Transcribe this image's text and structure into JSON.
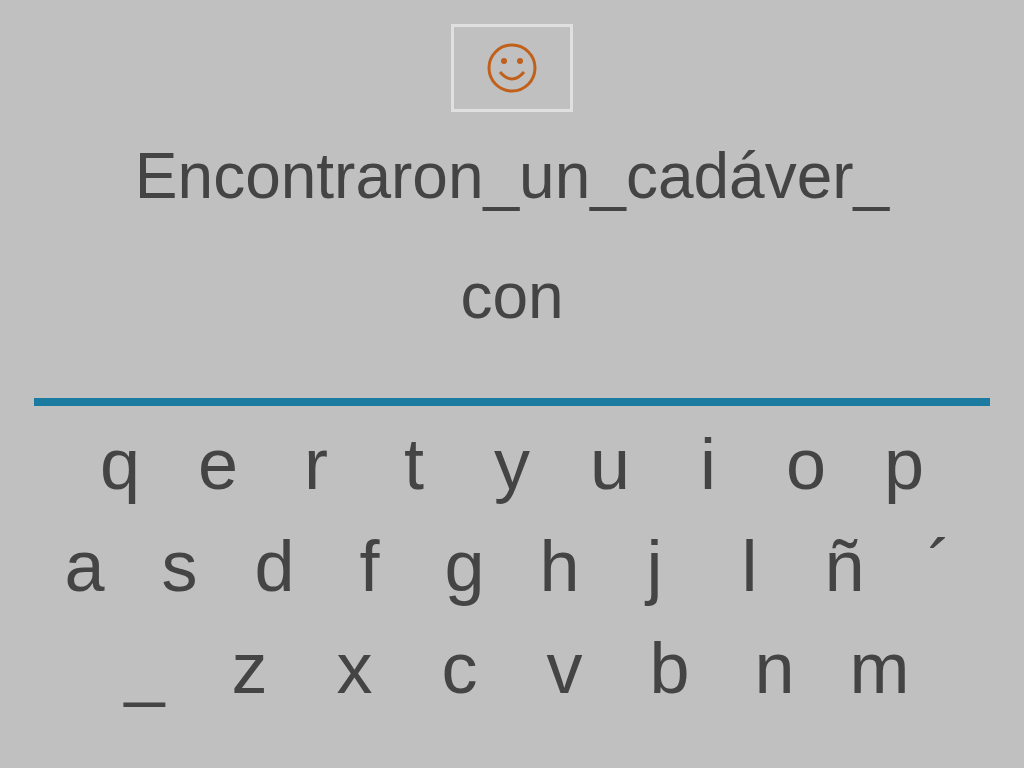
{
  "prompt_lines": [
    "Encontraron_un_cadáver_",
    "con"
  ],
  "keyboard_rows": [
    [
      "q",
      "e",
      "r",
      "t",
      "y",
      "u",
      "i",
      "o",
      "p"
    ],
    [
      "a",
      "s",
      "d",
      "f",
      "g",
      "h",
      "j",
      "l",
      "ñ",
      "´"
    ],
    [
      "_",
      "z",
      "x",
      "c",
      "v",
      "b",
      "n",
      "m"
    ]
  ]
}
